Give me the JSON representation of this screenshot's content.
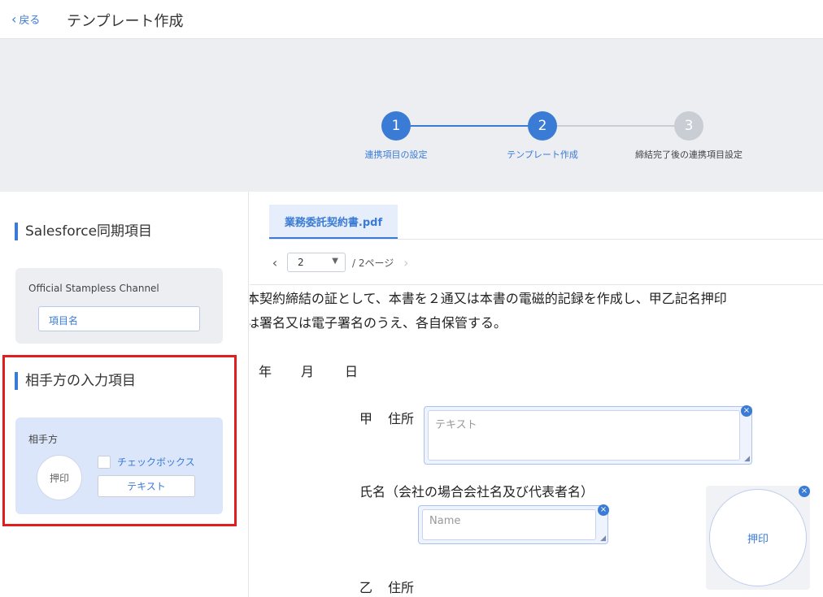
{
  "header": {
    "back_label": "戻る",
    "title": "テンプレート作成"
  },
  "stepper": {
    "steps": [
      {
        "number": "1",
        "label": "連携項目の設定",
        "state": "done"
      },
      {
        "number": "2",
        "label": "テンプレート作成",
        "state": "active"
      },
      {
        "number": "3",
        "label": "締結完了後の連携項目設定",
        "state": "pending"
      }
    ],
    "colors": {
      "active": "#3a7bd5",
      "pending": "#c9cdd4"
    }
  },
  "sidebar": {
    "salesforce_title": "Salesforce同期項目",
    "channel_name": "Official Stampless Channel",
    "item_name_field": "項目名",
    "counterparty_title": "相手方の入力項目",
    "counterparty_label": "相手方",
    "seal_label": "押印",
    "checkbox_label": "チェックボックス",
    "text_button_label": "テキスト"
  },
  "viewer": {
    "tab_label": "業務委託契約書.pdf",
    "current_page": "2",
    "page_total": "/ 2ページ",
    "doc_lines": [
      "本契約締結の証として、本書を２通又は本書の電磁的記録を作成し、甲乙記名押印",
      "は署名又は電子署名のうえ、各自保管する。"
    ],
    "date_year": "年",
    "date_month": "月",
    "date_day": "日",
    "party_a_label": "甲",
    "address_label": "住所",
    "text_field_placeholder": "テキスト",
    "name_label": "氏名（会社の場合会社名及び代表者名）",
    "name_field_placeholder": "Name",
    "seal_field_label": "押印",
    "party_b_label": "乙"
  }
}
